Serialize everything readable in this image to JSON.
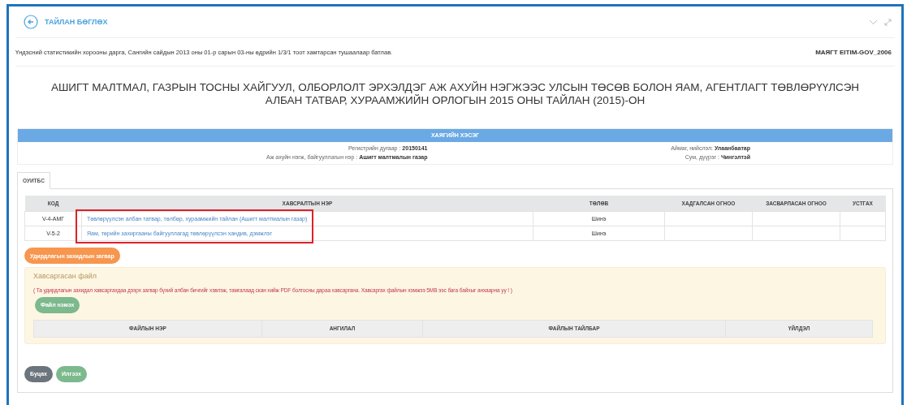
{
  "header": {
    "title": "ТАЙЛАН БӨГЛӨХ"
  },
  "approval_note": "Үндэсний статистикийн хорооны дарга, Сангийн сайдын 2013 оны 01-р сарын 03-ны өдрийн 1/3/1 тоот хамтарсан тушаалаар батлав.",
  "form_code": "МАЯГТ EITIM-GOV_2006",
  "report_title": "АШИГТ МАЛТМАЛ, ГАЗРЫН ТОСНЫ ХАЙГУУЛ, ОЛБОРЛОЛТ ЭРХЭЛДЭГ АЖ АХУЙН НЭГЖЭЭС УЛСЫН ТӨСӨВ БОЛОН ЯАМ, АГЕНТЛАГТ ТӨВЛӨРҮҮЛСЭН АЛБАН ТАТВАР, ХУРААМЖИЙН ОРЛОГЫН 2015 ОНЫ ТАЙЛАН (2015)-ОН",
  "info_panel": {
    "title": "ХАЯГИЙН ХЭСЭГ",
    "fields": [
      {
        "label": "Регистрийн дугаар :",
        "value": "20150141"
      },
      {
        "label": "Аймаг, нийслэл:",
        "value": "Улаанбаатар"
      },
      {
        "label": "Аж ахуйн нэгж, байгууллагын нэр :",
        "value": "Ашигт малтмалын газар"
      },
      {
        "label": "Сум, дүүрэг :",
        "value": "Чингэлтэй"
      }
    ]
  },
  "tabs": [
    {
      "label": "ОУИТБС",
      "selected": true
    }
  ],
  "attachments_table": {
    "columns": [
      "КОД",
      "ХАВСРАЛТЫН НЭР",
      "ТӨЛӨВ",
      "ХАДГАЛСАН ОГНОО",
      "ЗАСВАРЛАСАН ОГНОО",
      "УСТГАХ"
    ],
    "rows": [
      {
        "code": "V-4-АМГ",
        "name": "Төвлөрүүлсэн албан татвар, төлбөр, хураамжийн тайлан (Ашигт малтмалын газар)",
        "status": "Шинэ",
        "highlighted": true
      },
      {
        "code": "V-5-2",
        "name": "Яам, төрийн захиргааны байгууллагад төвлөрүүлсэн хандив, дэмжлэг",
        "status": "Шинэ",
        "highlighted": true
      }
    ]
  },
  "template_button": "Удирдлагын захидлын загвар",
  "file_section": {
    "title": "Хавсаргасан файл",
    "notice": "( Та удирдлагын захидал хавсаргахдаа дээрх загвар бүхий албан бичгийг хэвлэж, тамгалаад скан хийж PDF болгосны дараа хавсаргана. Хавсаргах файлын хэмжээ 5MB ээс бага байхыг анхаарна уу ! )",
    "add_button": "Файл нэмэх",
    "columns": [
      "ФАЙЛЫН НЭР",
      "АНГИЛАЛ",
      "ФАЙЛЫН ТАЙЛБАР",
      "ҮЙЛДЭЛ"
    ]
  },
  "footer_buttons": [
    {
      "label": "Буцах",
      "kind": "secondary"
    },
    {
      "label": "Илгээх",
      "kind": "primary"
    }
  ]
}
